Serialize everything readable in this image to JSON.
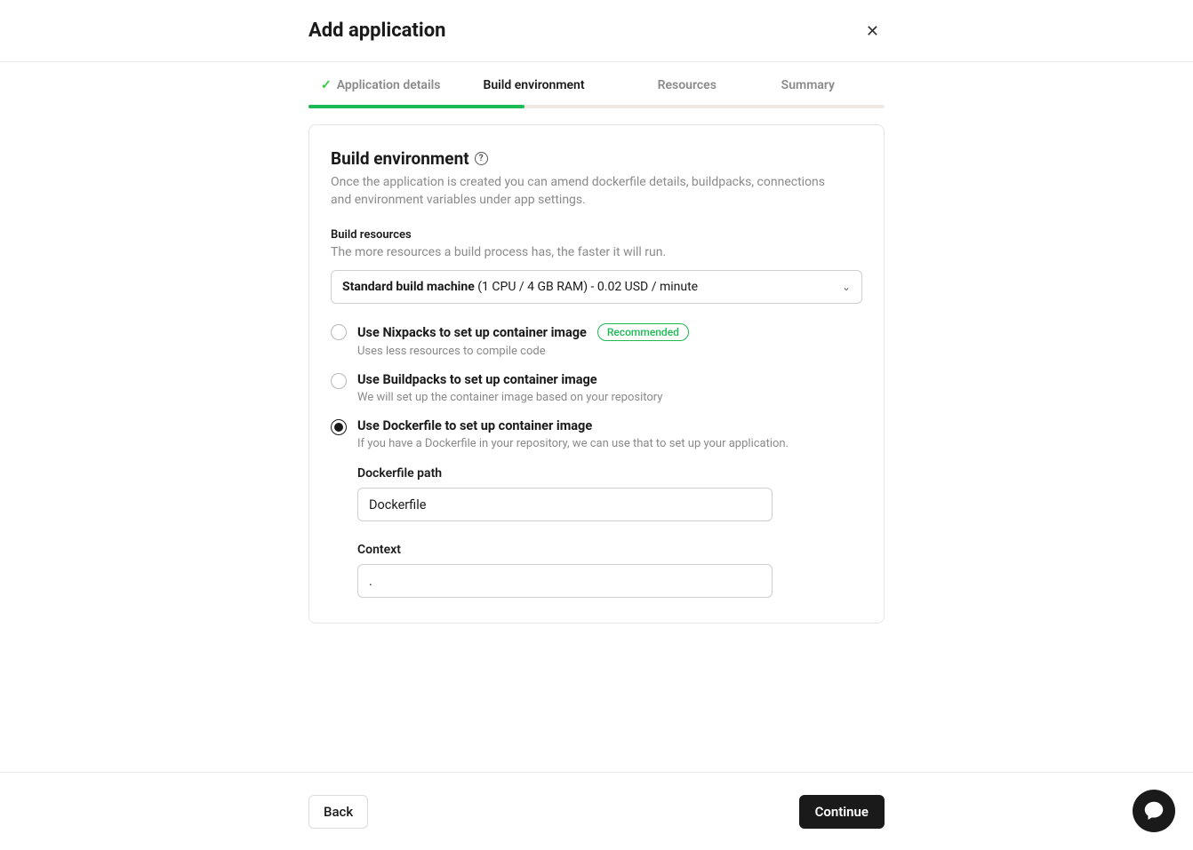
{
  "header": {
    "title": "Add application"
  },
  "stepper": {
    "steps": [
      {
        "label": "Application details",
        "completed": true
      },
      {
        "label": "Build environment",
        "active": true
      },
      {
        "label": "Resources"
      },
      {
        "label": "Summary"
      }
    ]
  },
  "section": {
    "title": "Build environment",
    "description": "Once the application is created you can amend dockerfile details, buildpacks, connections and environment variables under app settings."
  },
  "build_resources": {
    "label": "Build resources",
    "description": "The more resources a build process has, the faster it will run.",
    "select_bold": "Standard build machine ",
    "select_rest": "(1 CPU / 4 GB RAM) - 0.02 USD / minute"
  },
  "options": {
    "nixpacks": {
      "title": "Use Nixpacks to set up container image",
      "badge": "Recommended",
      "sub": "Uses less resources to compile code"
    },
    "buildpacks": {
      "title": "Use Buildpacks to set up container image",
      "sub": "We will set up the container image based on your repository"
    },
    "dockerfile": {
      "title": "Use Dockerfile to set up container image",
      "sub": "If you have a Dockerfile in your repository, we can use that to set up your application.",
      "path_label": "Dockerfile path",
      "path_value": "Dockerfile",
      "context_label": "Context",
      "context_value": "."
    }
  },
  "footer": {
    "back": "Back",
    "continue": "Continue"
  }
}
